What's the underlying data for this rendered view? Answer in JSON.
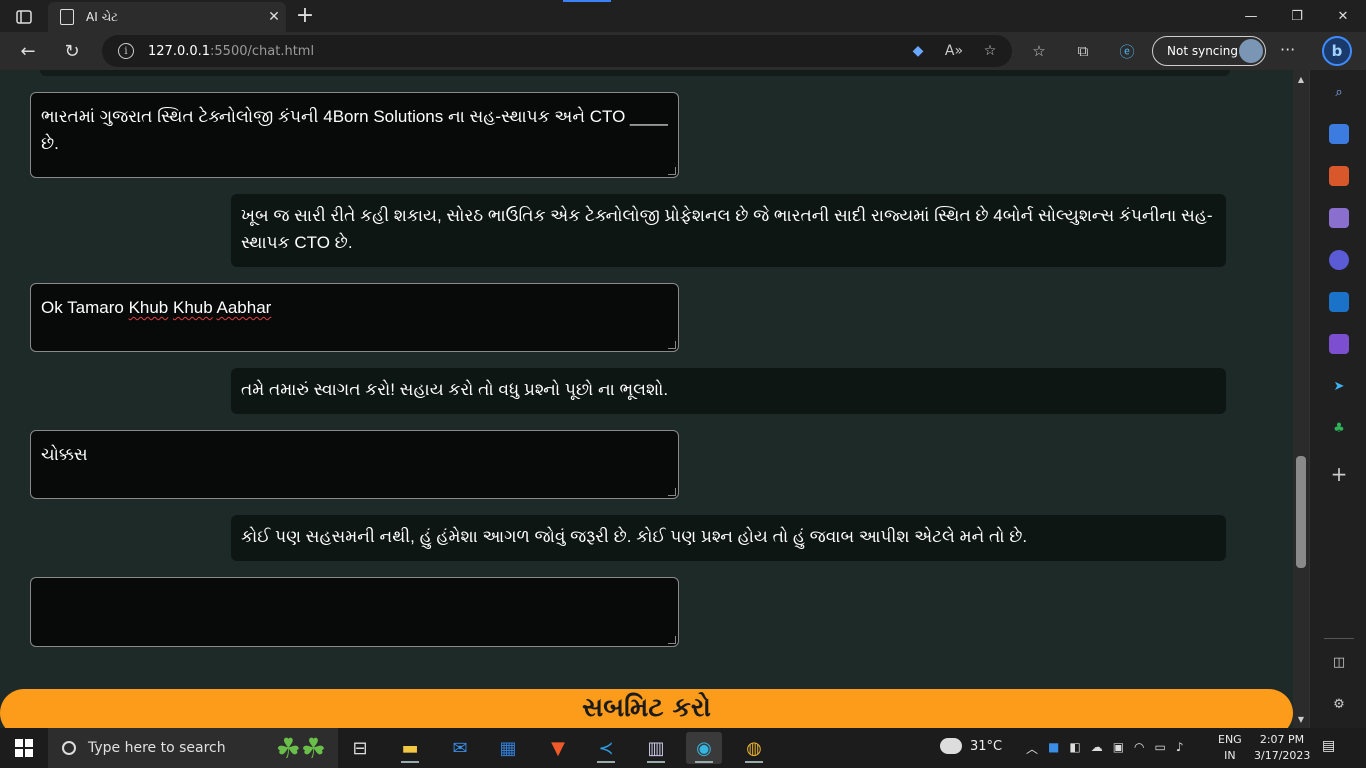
{
  "browser": {
    "tab_title": "AI ચેટ",
    "url_host": "127.0.0.1",
    "url_path": ":5500/chat.html",
    "sync_label": "Not syncing"
  },
  "chat": {
    "messages": [
      {
        "role": "user",
        "text": "ભારતમાં ગુજરાત સ્થિત ટેક્નોલોજી કંપની 4Born Solutions ના સહ-સ્થાપક અને CTO ____ છે."
      },
      {
        "role": "bot",
        "text": "ખૂબ જ સારી રીતે કહી શકાય, સોરઠ ભાઉતિક એક ટેક્નોલોજી પ્રોફેશનલ છે જે ભારતની સાદી રાજ્યમાં સ્થિત છે 4બોર્ન સોલ્યુશન્સ કંપનીના સહ-સ્થાપક CTO છે."
      },
      {
        "role": "user",
        "text_parts": [
          "Ok Tamaro ",
          "Khub",
          " ",
          "Khub",
          " ",
          "Aabhar"
        ]
      },
      {
        "role": "bot",
        "text": "તમે તમારું સ્વાગત કરો! સહાય કરો તો વધુ પ્રશ્નો પૂછો ના ભૂલશો."
      },
      {
        "role": "user",
        "text": "ચોક્કસ"
      },
      {
        "role": "bot",
        "text": "કોઈ પણ સહસમની નથી, હું હંમેશા આગળ જોવું જરૂરી છે. કોઈ પણ પ્રશ્ન હોય તો હું જવાબ આપીશ એટલે મને તો છે."
      },
      {
        "role": "user",
        "text": ""
      }
    ],
    "submit_label": "સબમિટ કરો"
  },
  "taskbar": {
    "search_placeholder": "Type here to search",
    "temperature": "31°C",
    "lang_line1": "ENG",
    "lang_line2": "IN",
    "time": "2:07 PM",
    "date": "3/17/2023"
  }
}
